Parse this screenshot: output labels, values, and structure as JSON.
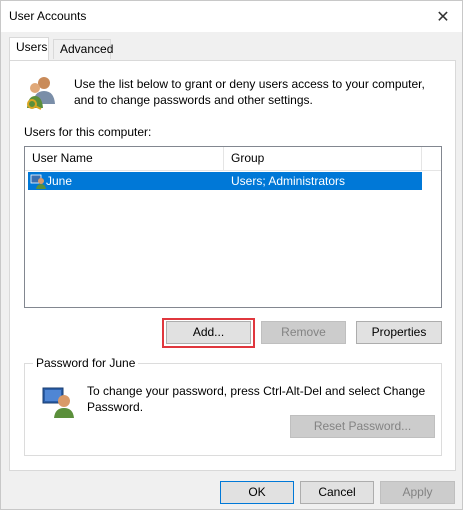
{
  "window": {
    "title": "User Accounts",
    "close_symbol": "✕"
  },
  "tabs": [
    {
      "label": "Users",
      "active": true
    },
    {
      "label": "Advanced",
      "active": false
    }
  ],
  "users_tab": {
    "intro_text": "Use the list below to grant or deny users access to your computer, and to change passwords and other settings.",
    "list_label": "Users for this computer:",
    "columns": [
      "User Name",
      "Group"
    ],
    "rows": [
      {
        "user": "June",
        "group": "Users; Administrators",
        "selected": true
      }
    ],
    "buttons": {
      "add": "Add...",
      "remove": "Remove",
      "properties": "Properties"
    },
    "password_group": {
      "title": "Password for June",
      "text": "To change your password, press Ctrl-Alt-Del and select Change Password.",
      "reset_button": "Reset Password..."
    }
  },
  "footer": {
    "ok": "OK",
    "cancel": "Cancel",
    "apply": "Apply"
  },
  "colors": {
    "selection": "#0078d7",
    "highlight_border": "#e0373e"
  }
}
